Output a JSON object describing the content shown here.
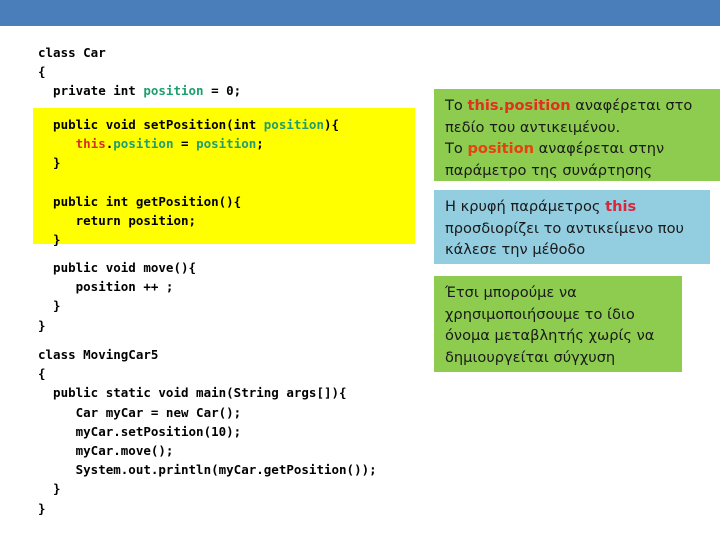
{
  "colors": {
    "banner": "#4a7ebb",
    "highlight": "#ffff00",
    "note_green": "#8dcc4e",
    "note_cyan": "#92cde0",
    "keyword_this": "#d93025",
    "keyword_position": "#1f9e6e",
    "page_background": "#ffffff"
  },
  "code": {
    "top": {
      "line1": "class Car",
      "line2": "{",
      "line3_a": "  private int ",
      "line3_b": "position",
      "line3_c": " = 0;"
    },
    "highlight": {
      "line1_a": "  public void setPosition(int ",
      "line1_b": "position",
      "line1_c": "){",
      "line2_a": "     ",
      "line2_b": "this",
      "line2_c": ".",
      "line2_d": "position",
      "line2_e": " = ",
      "line2_f": "position",
      "line2_g": ";",
      "line3": "  }",
      "line4": "",
      "line5": "  public int getPosition(){",
      "line6_a": "     return ",
      "line6_b": "position",
      "line6_c": ";",
      "line7": "  }"
    },
    "middle": {
      "line1": "  public void move(){",
      "line2": "     position ++ ;",
      "line3": "  }",
      "line4": "}"
    },
    "bottom": {
      "line1": "class MovingCar5",
      "line2": "{",
      "line3": "  public static void main(String args[]){",
      "line4": "     Car myCar = new Car();",
      "line5": "     myCar.setPosition(10);",
      "line6": "     myCar.move();",
      "line7": "     System.out.println(myCar.getPosition());",
      "line8": "  }",
      "line9": "}"
    }
  },
  "notes": {
    "note1": {
      "line1_a": "Το ",
      "line1_b": "this.position",
      "line1_c": " αναφέρεται στο",
      "line2": "πεδίο του αντικειμένου.",
      "line3_a": "Το ",
      "line3_b": "position",
      "line3_c": " αναφέρεται στην",
      "line4": "παράμετρο της συνάρτησης"
    },
    "note2": {
      "line1_a": "Η κρυφή παράμετρος ",
      "line1_b": "this",
      "line2": "προσδιορίζει το αντικείμενο που",
      "line3": "κάλεσε την μέθοδο"
    },
    "note3": {
      "line1": "Έτσι μπορούμε να",
      "line2": "χρησιμοποιήσουμε το ίδιο",
      "line3": "όνομα μεταβλητής χωρίς να",
      "line4": "δημιουργείται σύγχυση"
    }
  }
}
